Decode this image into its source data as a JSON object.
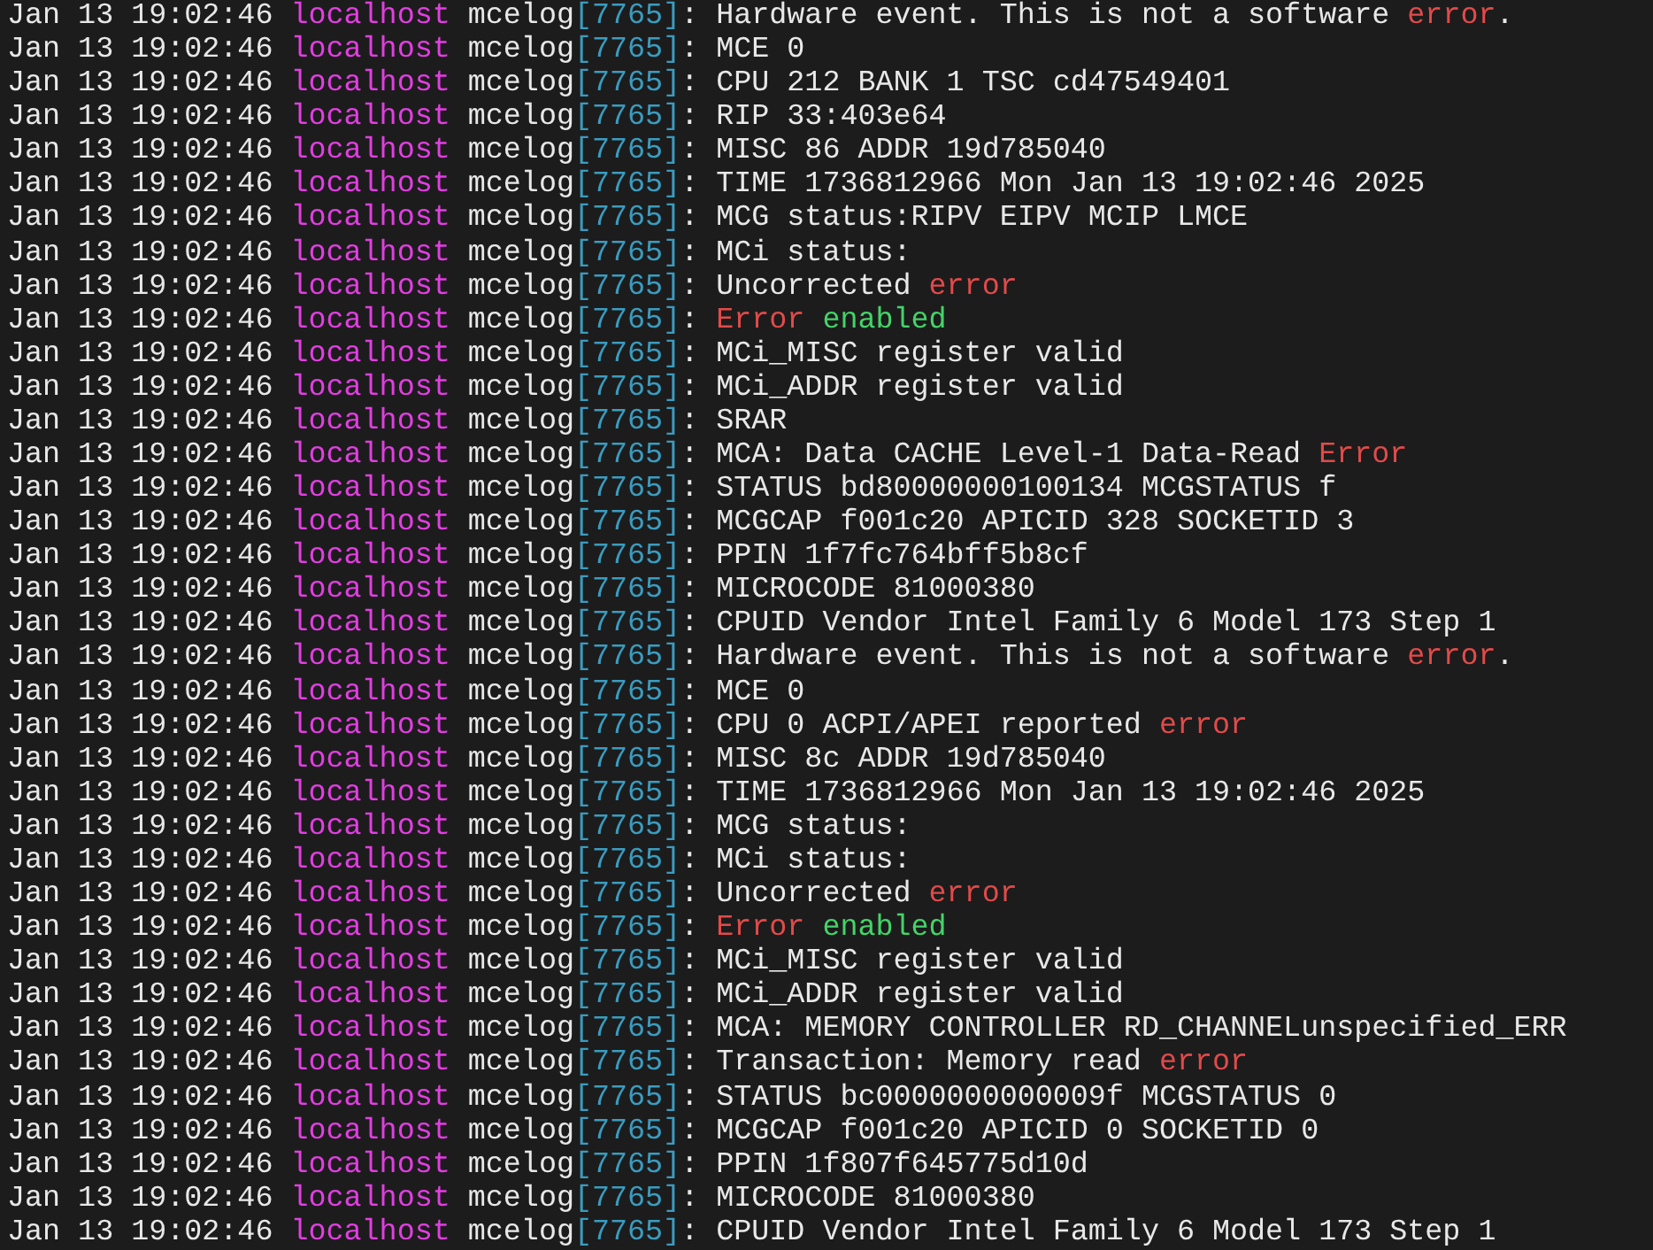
{
  "terminal": {
    "lines": [
      {
        "timestamp": "Jan 13 19:02:46",
        "host": "localhost",
        "process": "mcelog",
        "pid": "[7765]",
        "message": [
          {
            "text": ": Hardware event. This is not a software ",
            "kind": "plain"
          },
          {
            "text": "error",
            "kind": "error"
          },
          {
            "text": ".",
            "kind": "plain"
          }
        ]
      },
      {
        "timestamp": "Jan 13 19:02:46",
        "host": "localhost",
        "process": "mcelog",
        "pid": "[7765]",
        "message": [
          {
            "text": ": MCE 0",
            "kind": "plain"
          }
        ]
      },
      {
        "timestamp": "Jan 13 19:02:46",
        "host": "localhost",
        "process": "mcelog",
        "pid": "[7765]",
        "message": [
          {
            "text": ": CPU 212 BANK 1 TSC cd47549401",
            "kind": "plain"
          }
        ]
      },
      {
        "timestamp": "Jan 13 19:02:46",
        "host": "localhost",
        "process": "mcelog",
        "pid": "[7765]",
        "message": [
          {
            "text": ": RIP 33:403e64",
            "kind": "plain"
          }
        ]
      },
      {
        "timestamp": "Jan 13 19:02:46",
        "host": "localhost",
        "process": "mcelog",
        "pid": "[7765]",
        "message": [
          {
            "text": ": MISC 86 ADDR 19d785040",
            "kind": "plain"
          }
        ]
      },
      {
        "timestamp": "Jan 13 19:02:46",
        "host": "localhost",
        "process": "mcelog",
        "pid": "[7765]",
        "message": [
          {
            "text": ": TIME 1736812966 Mon Jan 13 19:02:46 2025",
            "kind": "plain"
          }
        ]
      },
      {
        "timestamp": "Jan 13 19:02:46",
        "host": "localhost",
        "process": "mcelog",
        "pid": "[7765]",
        "message": [
          {
            "text": ": MCG status:RIPV EIPV MCIP LMCE",
            "kind": "plain"
          }
        ]
      },
      {
        "timestamp": "Jan 13 19:02:46",
        "host": "localhost",
        "process": "mcelog",
        "pid": "[7765]",
        "message": [
          {
            "text": ": MCi status:",
            "kind": "plain"
          }
        ]
      },
      {
        "timestamp": "Jan 13 19:02:46",
        "host": "localhost",
        "process": "mcelog",
        "pid": "[7765]",
        "message": [
          {
            "text": ": Uncorrected ",
            "kind": "plain"
          },
          {
            "text": "error",
            "kind": "error"
          }
        ]
      },
      {
        "timestamp": "Jan 13 19:02:46",
        "host": "localhost",
        "process": "mcelog",
        "pid": "[7765]",
        "message": [
          {
            "text": ": ",
            "kind": "plain"
          },
          {
            "text": "Error",
            "kind": "error"
          },
          {
            "text": " enabled",
            "kind": "ok"
          }
        ]
      },
      {
        "timestamp": "Jan 13 19:02:46",
        "host": "localhost",
        "process": "mcelog",
        "pid": "[7765]",
        "message": [
          {
            "text": ": MCi_MISC register valid",
            "kind": "plain"
          }
        ]
      },
      {
        "timestamp": "Jan 13 19:02:46",
        "host": "localhost",
        "process": "mcelog",
        "pid": "[7765]",
        "message": [
          {
            "text": ": MCi_ADDR register valid",
            "kind": "plain"
          }
        ]
      },
      {
        "timestamp": "Jan 13 19:02:46",
        "host": "localhost",
        "process": "mcelog",
        "pid": "[7765]",
        "message": [
          {
            "text": ": SRAR",
            "kind": "plain"
          }
        ]
      },
      {
        "timestamp": "Jan 13 19:02:46",
        "host": "localhost",
        "process": "mcelog",
        "pid": "[7765]",
        "message": [
          {
            "text": ": MCA: Data CACHE Level-1 Data-Read ",
            "kind": "plain"
          },
          {
            "text": "Error",
            "kind": "error"
          }
        ]
      },
      {
        "timestamp": "Jan 13 19:02:46",
        "host": "localhost",
        "process": "mcelog",
        "pid": "[7765]",
        "message": [
          {
            "text": ": STATUS bd80000000100134 MCGSTATUS f",
            "kind": "plain"
          }
        ]
      },
      {
        "timestamp": "Jan 13 19:02:46",
        "host": "localhost",
        "process": "mcelog",
        "pid": "[7765]",
        "message": [
          {
            "text": ": MCGCAP f001c20 APICID 328 SOCKETID 3",
            "kind": "plain"
          }
        ]
      },
      {
        "timestamp": "Jan 13 19:02:46",
        "host": "localhost",
        "process": "mcelog",
        "pid": "[7765]",
        "message": [
          {
            "text": ": PPIN 1f7fc764bff5b8cf",
            "kind": "plain"
          }
        ]
      },
      {
        "timestamp": "Jan 13 19:02:46",
        "host": "localhost",
        "process": "mcelog",
        "pid": "[7765]",
        "message": [
          {
            "text": ": MICROCODE 81000380",
            "kind": "plain"
          }
        ]
      },
      {
        "timestamp": "Jan 13 19:02:46",
        "host": "localhost",
        "process": "mcelog",
        "pid": "[7765]",
        "message": [
          {
            "text": ": CPUID Vendor Intel Family 6 Model 173 Step 1",
            "kind": "plain"
          }
        ]
      },
      {
        "timestamp": "Jan 13 19:02:46",
        "host": "localhost",
        "process": "mcelog",
        "pid": "[7765]",
        "message": [
          {
            "text": ": Hardware event. This is not a software ",
            "kind": "plain"
          },
          {
            "text": "error",
            "kind": "error"
          },
          {
            "text": ".",
            "kind": "plain"
          }
        ]
      },
      {
        "timestamp": "Jan 13 19:02:46",
        "host": "localhost",
        "process": "mcelog",
        "pid": "[7765]",
        "message": [
          {
            "text": ": MCE 0",
            "kind": "plain"
          }
        ]
      },
      {
        "timestamp": "Jan 13 19:02:46",
        "host": "localhost",
        "process": "mcelog",
        "pid": "[7765]",
        "message": [
          {
            "text": ": CPU 0 ACPI/APEI reported ",
            "kind": "plain"
          },
          {
            "text": "error",
            "kind": "error"
          }
        ]
      },
      {
        "timestamp": "Jan 13 19:02:46",
        "host": "localhost",
        "process": "mcelog",
        "pid": "[7765]",
        "message": [
          {
            "text": ": MISC 8c ADDR 19d785040",
            "kind": "plain"
          }
        ]
      },
      {
        "timestamp": "Jan 13 19:02:46",
        "host": "localhost",
        "process": "mcelog",
        "pid": "[7765]",
        "message": [
          {
            "text": ": TIME 1736812966 Mon Jan 13 19:02:46 2025",
            "kind": "plain"
          }
        ]
      },
      {
        "timestamp": "Jan 13 19:02:46",
        "host": "localhost",
        "process": "mcelog",
        "pid": "[7765]",
        "message": [
          {
            "text": ": MCG status:",
            "kind": "plain"
          }
        ]
      },
      {
        "timestamp": "Jan 13 19:02:46",
        "host": "localhost",
        "process": "mcelog",
        "pid": "[7765]",
        "message": [
          {
            "text": ": MCi status:",
            "kind": "plain"
          }
        ]
      },
      {
        "timestamp": "Jan 13 19:02:46",
        "host": "localhost",
        "process": "mcelog",
        "pid": "[7765]",
        "message": [
          {
            "text": ": Uncorrected ",
            "kind": "plain"
          },
          {
            "text": "error",
            "kind": "error"
          }
        ]
      },
      {
        "timestamp": "Jan 13 19:02:46",
        "host": "localhost",
        "process": "mcelog",
        "pid": "[7765]",
        "message": [
          {
            "text": ": ",
            "kind": "plain"
          },
          {
            "text": "Error",
            "kind": "error"
          },
          {
            "text": " enabled",
            "kind": "ok"
          }
        ]
      },
      {
        "timestamp": "Jan 13 19:02:46",
        "host": "localhost",
        "process": "mcelog",
        "pid": "[7765]",
        "message": [
          {
            "text": ": MCi_MISC register valid",
            "kind": "plain"
          }
        ]
      },
      {
        "timestamp": "Jan 13 19:02:46",
        "host": "localhost",
        "process": "mcelog",
        "pid": "[7765]",
        "message": [
          {
            "text": ": MCi_ADDR register valid",
            "kind": "plain"
          }
        ]
      },
      {
        "timestamp": "Jan 13 19:02:46",
        "host": "localhost",
        "process": "mcelog",
        "pid": "[7765]",
        "message": [
          {
            "text": ": MCA: MEMORY CONTROLLER RD_CHANNELunspecified_ERR",
            "kind": "plain"
          }
        ]
      },
      {
        "timestamp": "Jan 13 19:02:46",
        "host": "localhost",
        "process": "mcelog",
        "pid": "[7765]",
        "message": [
          {
            "text": ": Transaction: Memory read ",
            "kind": "plain"
          },
          {
            "text": "error",
            "kind": "error"
          }
        ]
      },
      {
        "timestamp": "Jan 13 19:02:46",
        "host": "localhost",
        "process": "mcelog",
        "pid": "[7765]",
        "message": [
          {
            "text": ": STATUS bc0000000000009f MCGSTATUS 0",
            "kind": "plain"
          }
        ]
      },
      {
        "timestamp": "Jan 13 19:02:46",
        "host": "localhost",
        "process": "mcelog",
        "pid": "[7765]",
        "message": [
          {
            "text": ": MCGCAP f001c20 APICID 0 SOCKETID 0",
            "kind": "plain"
          }
        ]
      },
      {
        "timestamp": "Jan 13 19:02:46",
        "host": "localhost",
        "process": "mcelog",
        "pid": "[7765]",
        "message": [
          {
            "text": ": PPIN 1f807f645775d10d",
            "kind": "plain"
          }
        ]
      },
      {
        "timestamp": "Jan 13 19:02:46",
        "host": "localhost",
        "process": "mcelog",
        "pid": "[7765]",
        "message": [
          {
            "text": ": MICROCODE 81000380",
            "kind": "plain"
          }
        ]
      },
      {
        "timestamp": "Jan 13 19:02:46",
        "host": "localhost",
        "process": "mcelog",
        "pid": "[7765]",
        "message": [
          {
            "text": ": CPUID Vendor Intel Family 6 Model 173 Step 1",
            "kind": "plain"
          }
        ]
      }
    ]
  }
}
